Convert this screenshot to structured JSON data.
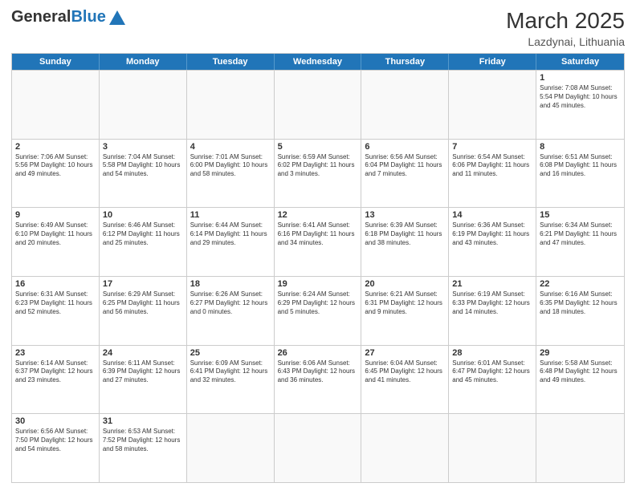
{
  "header": {
    "logo": {
      "general": "General",
      "blue": "Blue",
      "tagline": ""
    },
    "title": "March 2025",
    "location": "Lazdynai, Lithuania"
  },
  "days_of_week": [
    "Sunday",
    "Monday",
    "Tuesday",
    "Wednesday",
    "Thursday",
    "Friday",
    "Saturday"
  ],
  "weeks": [
    [
      {
        "day": "",
        "info": ""
      },
      {
        "day": "",
        "info": ""
      },
      {
        "day": "",
        "info": ""
      },
      {
        "day": "",
        "info": ""
      },
      {
        "day": "",
        "info": ""
      },
      {
        "day": "",
        "info": ""
      },
      {
        "day": "1",
        "info": "Sunrise: 7:08 AM\nSunset: 5:54 PM\nDaylight: 10 hours and 45 minutes."
      }
    ],
    [
      {
        "day": "2",
        "info": "Sunrise: 7:06 AM\nSunset: 5:56 PM\nDaylight: 10 hours and 49 minutes."
      },
      {
        "day": "3",
        "info": "Sunrise: 7:04 AM\nSunset: 5:58 PM\nDaylight: 10 hours and 54 minutes."
      },
      {
        "day": "4",
        "info": "Sunrise: 7:01 AM\nSunset: 6:00 PM\nDaylight: 10 hours and 58 minutes."
      },
      {
        "day": "5",
        "info": "Sunrise: 6:59 AM\nSunset: 6:02 PM\nDaylight: 11 hours and 3 minutes."
      },
      {
        "day": "6",
        "info": "Sunrise: 6:56 AM\nSunset: 6:04 PM\nDaylight: 11 hours and 7 minutes."
      },
      {
        "day": "7",
        "info": "Sunrise: 6:54 AM\nSunset: 6:06 PM\nDaylight: 11 hours and 11 minutes."
      },
      {
        "day": "8",
        "info": "Sunrise: 6:51 AM\nSunset: 6:08 PM\nDaylight: 11 hours and 16 minutes."
      }
    ],
    [
      {
        "day": "9",
        "info": "Sunrise: 6:49 AM\nSunset: 6:10 PM\nDaylight: 11 hours and 20 minutes."
      },
      {
        "day": "10",
        "info": "Sunrise: 6:46 AM\nSunset: 6:12 PM\nDaylight: 11 hours and 25 minutes."
      },
      {
        "day": "11",
        "info": "Sunrise: 6:44 AM\nSunset: 6:14 PM\nDaylight: 11 hours and 29 minutes."
      },
      {
        "day": "12",
        "info": "Sunrise: 6:41 AM\nSunset: 6:16 PM\nDaylight: 11 hours and 34 minutes."
      },
      {
        "day": "13",
        "info": "Sunrise: 6:39 AM\nSunset: 6:18 PM\nDaylight: 11 hours and 38 minutes."
      },
      {
        "day": "14",
        "info": "Sunrise: 6:36 AM\nSunset: 6:19 PM\nDaylight: 11 hours and 43 minutes."
      },
      {
        "day": "15",
        "info": "Sunrise: 6:34 AM\nSunset: 6:21 PM\nDaylight: 11 hours and 47 minutes."
      }
    ],
    [
      {
        "day": "16",
        "info": "Sunrise: 6:31 AM\nSunset: 6:23 PM\nDaylight: 11 hours and 52 minutes."
      },
      {
        "day": "17",
        "info": "Sunrise: 6:29 AM\nSunset: 6:25 PM\nDaylight: 11 hours and 56 minutes."
      },
      {
        "day": "18",
        "info": "Sunrise: 6:26 AM\nSunset: 6:27 PM\nDaylight: 12 hours and 0 minutes."
      },
      {
        "day": "19",
        "info": "Sunrise: 6:24 AM\nSunset: 6:29 PM\nDaylight: 12 hours and 5 minutes."
      },
      {
        "day": "20",
        "info": "Sunrise: 6:21 AM\nSunset: 6:31 PM\nDaylight: 12 hours and 9 minutes."
      },
      {
        "day": "21",
        "info": "Sunrise: 6:19 AM\nSunset: 6:33 PM\nDaylight: 12 hours and 14 minutes."
      },
      {
        "day": "22",
        "info": "Sunrise: 6:16 AM\nSunset: 6:35 PM\nDaylight: 12 hours and 18 minutes."
      }
    ],
    [
      {
        "day": "23",
        "info": "Sunrise: 6:14 AM\nSunset: 6:37 PM\nDaylight: 12 hours and 23 minutes."
      },
      {
        "day": "24",
        "info": "Sunrise: 6:11 AM\nSunset: 6:39 PM\nDaylight: 12 hours and 27 minutes."
      },
      {
        "day": "25",
        "info": "Sunrise: 6:09 AM\nSunset: 6:41 PM\nDaylight: 12 hours and 32 minutes."
      },
      {
        "day": "26",
        "info": "Sunrise: 6:06 AM\nSunset: 6:43 PM\nDaylight: 12 hours and 36 minutes."
      },
      {
        "day": "27",
        "info": "Sunrise: 6:04 AM\nSunset: 6:45 PM\nDaylight: 12 hours and 41 minutes."
      },
      {
        "day": "28",
        "info": "Sunrise: 6:01 AM\nSunset: 6:47 PM\nDaylight: 12 hours and 45 minutes."
      },
      {
        "day": "29",
        "info": "Sunrise: 5:58 AM\nSunset: 6:48 PM\nDaylight: 12 hours and 49 minutes."
      }
    ],
    [
      {
        "day": "30",
        "info": "Sunrise: 6:56 AM\nSunset: 7:50 PM\nDaylight: 12 hours and 54 minutes."
      },
      {
        "day": "31",
        "info": "Sunrise: 6:53 AM\nSunset: 7:52 PM\nDaylight: 12 hours and 58 minutes."
      },
      {
        "day": "",
        "info": ""
      },
      {
        "day": "",
        "info": ""
      },
      {
        "day": "",
        "info": ""
      },
      {
        "day": "",
        "info": ""
      },
      {
        "day": "",
        "info": ""
      }
    ]
  ]
}
